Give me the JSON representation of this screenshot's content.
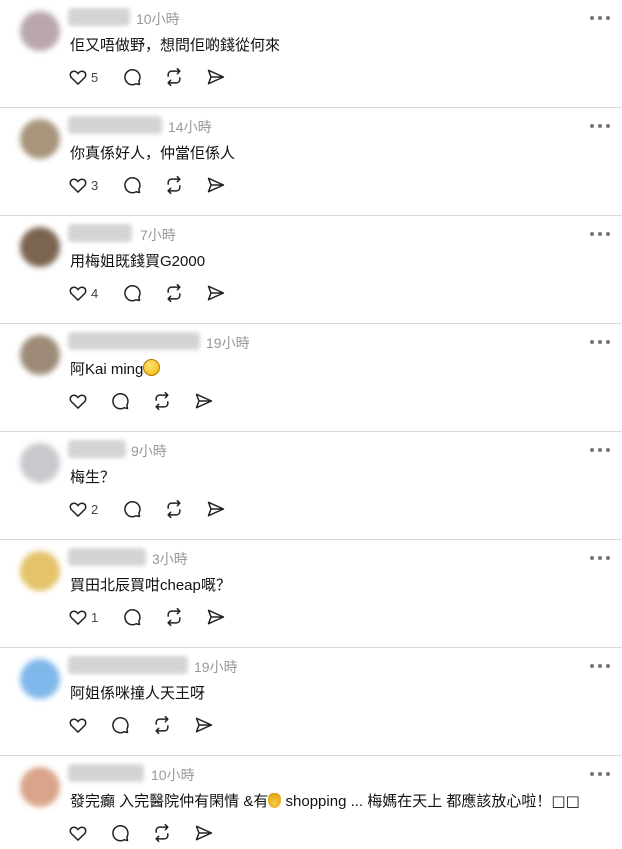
{
  "comments": [
    {
      "time": "10小時",
      "text": "佢又唔做野，想問佢啲錢從何來",
      "likes": "5",
      "avatar_color": "#b9a7ad"
    },
    {
      "time": "14小時",
      "text": "你真係好人，仲當佢係人",
      "likes": "3",
      "avatar_color": "#a8957c"
    },
    {
      "time": "7小時",
      "text": "用梅姐既錢買G2000",
      "likes": "4",
      "avatar_color": "#7b6450"
    },
    {
      "time": "19小時",
      "text": "阿Kai ming",
      "likes": "",
      "avatar_color": "#9d8b77"
    },
    {
      "time": "9小時",
      "text": "梅生？",
      "likes": "2",
      "avatar_color": "#c7c9cd"
    },
    {
      "time": "3小時",
      "text": "買田北辰買咁cheap嘅",
      "text_suffix": "？",
      "likes": "1",
      "avatar_color": "#e4c36a"
    },
    {
      "time": "19小時",
      "text": "阿姐係咪撞人天王呀",
      "likes": "",
      "avatar_color": "#7fb8ea"
    },
    {
      "time": "10小時",
      "text_a": "發完癲 入完醫院",
      "text_b": "仲有閑情 &有",
      "text_c": " shopping ... 梅媽在天上 都應該放心啦！",
      "likes": "",
      "avatar_color": "#d9a48a"
    }
  ],
  "icons": {
    "like": "heart-icon",
    "comment": "comment-bubble-icon",
    "repost": "repost-icon",
    "share": "send-icon",
    "more": "more-options-icon"
  },
  "glyphs": {
    "replacement": "",
    "box": "□□"
  }
}
